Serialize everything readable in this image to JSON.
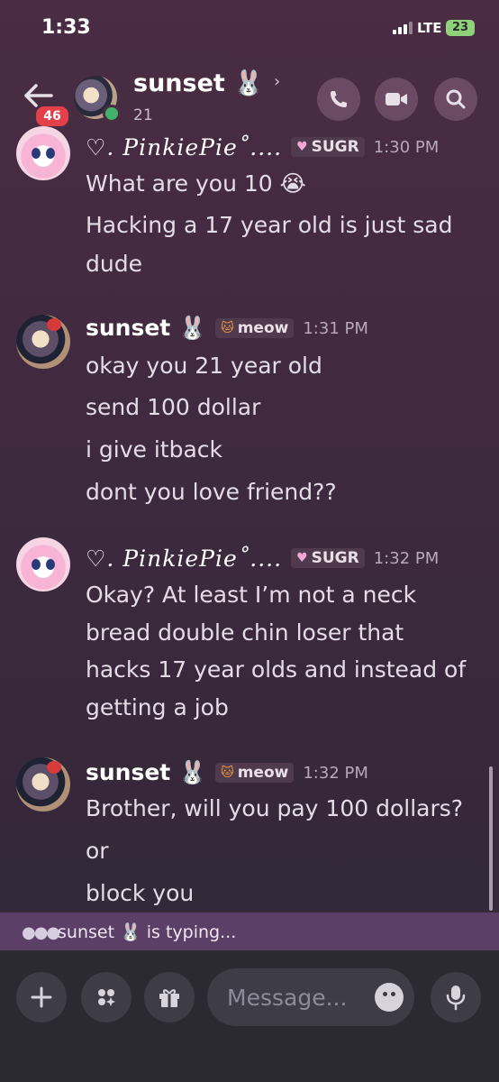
{
  "status_bar": {
    "time": "1:33",
    "network": "LTE",
    "battery": "23"
  },
  "header": {
    "channel_name": "sunset 🐰",
    "member_count": "21",
    "unread_badge": "46"
  },
  "messages": [
    {
      "author": "♡. PinkiePie˚....",
      "tag": "SUGR",
      "tag_icon": "heart-icon",
      "time": "1:30 PM",
      "lines": [
        "What are you 10 😭",
        "Hacking a 17 year old is just sad",
        "dude"
      ]
    },
    {
      "author": "sunset 🐰",
      "tag": "meow",
      "tag_icon": "cat-icon",
      "time": "1:31 PM",
      "lines": [
        "okay you 21 year old",
        "send 100 dollar",
        "i give itback",
        "dont you love friend??"
      ]
    },
    {
      "author": "♡. PinkiePie˚....",
      "tag": "SUGR",
      "tag_icon": "heart-icon",
      "time": "1:32 PM",
      "lines": [
        "Okay? At least I’m not a neck",
        "bread double chin loser that",
        "hacks 17 year olds and instead of",
        "getting a job"
      ]
    },
    {
      "author": "sunset 🐰",
      "tag": "meow",
      "tag_icon": "cat-icon",
      "time": "1:32 PM",
      "lines": [
        "Brother, will you pay 100 dollars?",
        "or",
        "block you"
      ]
    }
  ],
  "typing_indicator": "sunset 🐰 is typing...",
  "composer": {
    "placeholder": "Message..."
  },
  "colors": {
    "background": "#3f2a3f",
    "typing_bar": "#5b3f66",
    "badge": "#e3404a",
    "online": "#3fb36a"
  }
}
